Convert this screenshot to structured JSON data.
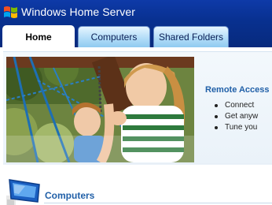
{
  "app": {
    "title": "Windows Home Server",
    "logo_icon": "windows-flag-icon"
  },
  "tabs": [
    {
      "label": "Home",
      "active": true
    },
    {
      "label": "Computers",
      "active": false
    },
    {
      "label": "Shared Folders",
      "active": false
    }
  ],
  "banner": {
    "photo": "children-on-swing-photo",
    "remote_access": {
      "title": "Remote Access",
      "items": [
        "Connect",
        "Get anyw",
        "Tune you"
      ]
    }
  },
  "section": {
    "title": "Computers",
    "icon": "monitor-icon"
  },
  "colors": {
    "header_bg": "#0b34a0",
    "tab_bg": "#b3ddf8",
    "accent_text": "#2160a8"
  }
}
